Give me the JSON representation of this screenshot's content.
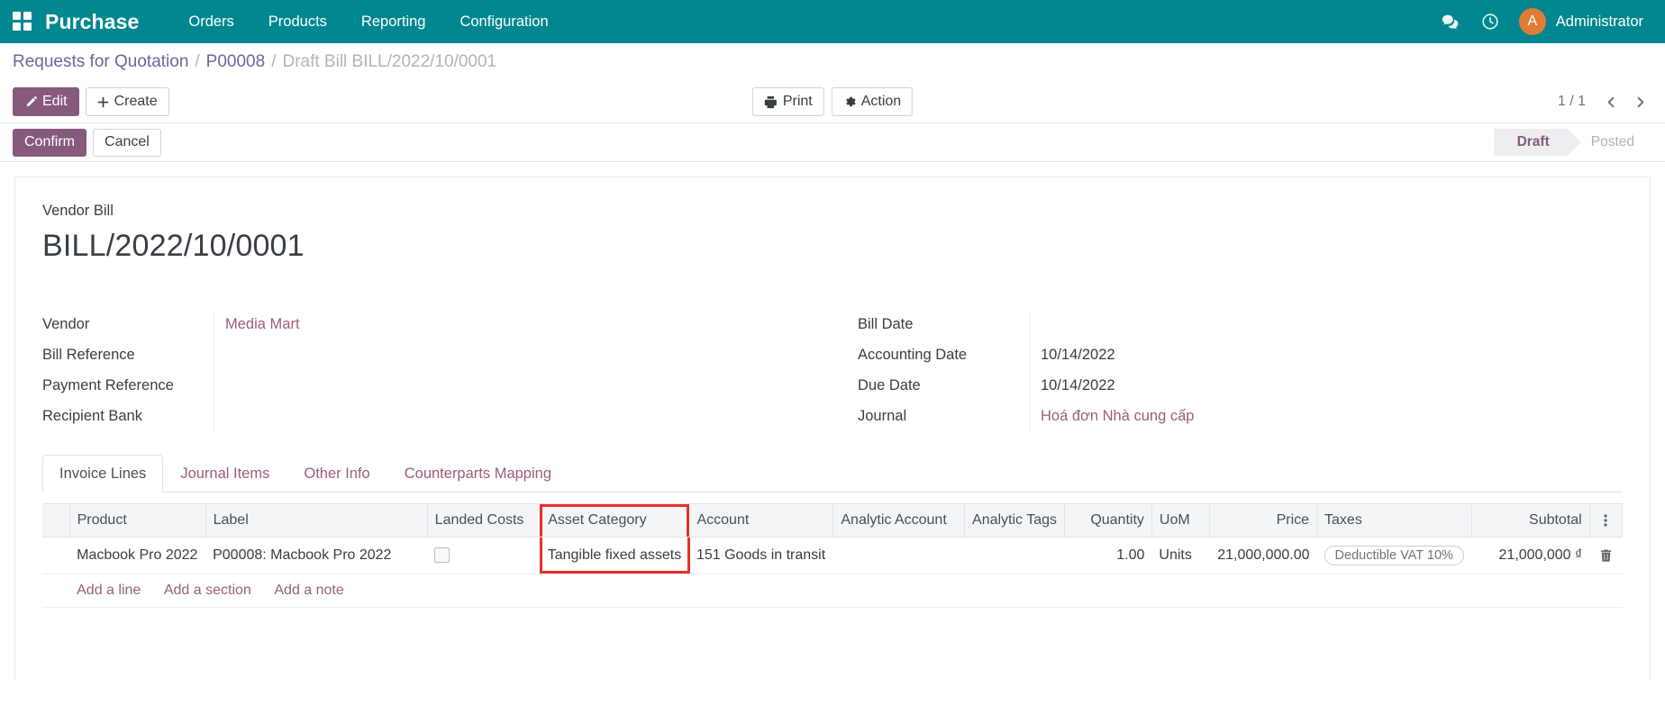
{
  "navbar": {
    "apps_icon": "apps-grid-icon",
    "brand": "Purchase",
    "menu": [
      {
        "label": "Orders"
      },
      {
        "label": "Products"
      },
      {
        "label": "Reporting"
      },
      {
        "label": "Configuration"
      }
    ],
    "messages_icon": "chat-bubble-icon",
    "activities_icon": "clock-icon",
    "avatar_initial": "A",
    "user_name": "Administrator",
    "brand_color": "#00878f",
    "avatar_color": "#e07b39"
  },
  "breadcrumb": {
    "items": [
      {
        "label": "Requests for Quotation",
        "active": false
      },
      {
        "label": "P00008",
        "active": false
      },
      {
        "label": "Draft Bill BILL/2022/10/0001",
        "active": true
      }
    ],
    "separator": "/"
  },
  "control_panel": {
    "edit_label": "Edit",
    "create_label": "Create",
    "print_label": "Print",
    "action_label": "Action",
    "pager_value": "1 / 1",
    "prev_icon": "chevron-left-icon",
    "next_icon": "chevron-right-icon"
  },
  "statusbar": {
    "confirm_label": "Confirm",
    "cancel_label": "Cancel",
    "steps": [
      {
        "label": "Draft",
        "state": "done"
      },
      {
        "label": "Posted",
        "state": "todo"
      }
    ],
    "active_color": "#875a7b"
  },
  "form": {
    "title_label": "Vendor Bill",
    "title": "BILL/2022/10/0001",
    "left_fields": [
      {
        "label": "Vendor",
        "value": "Media Mart",
        "is_link": true
      },
      {
        "label": "Bill Reference",
        "value": "",
        "is_link": false
      },
      {
        "label": "Payment Reference",
        "value": "",
        "is_link": false
      },
      {
        "label": "Recipient Bank",
        "value": "",
        "is_link": false
      }
    ],
    "right_fields": [
      {
        "label": "Bill Date",
        "value": "",
        "is_link": false
      },
      {
        "label": "Accounting Date",
        "value": "10/14/2022",
        "is_link": false
      },
      {
        "label": "Due Date",
        "value": "10/14/2022",
        "is_link": false
      },
      {
        "label": "Journal",
        "value": "Hoá đơn Nhà cung cấp",
        "is_link": true
      }
    ]
  },
  "notebook": {
    "tabs": [
      {
        "label": "Invoice Lines",
        "active": true
      },
      {
        "label": "Journal Items",
        "active": false
      },
      {
        "label": "Other Info",
        "active": false
      },
      {
        "label": "Counterparts Mapping",
        "active": false
      }
    ]
  },
  "lines_table": {
    "columns": [
      "Product",
      "Label",
      "Landed Costs",
      "Asset Category",
      "Account",
      "Analytic Account",
      "Analytic Tags",
      "Quantity",
      "UoM",
      "Price",
      "Taxes",
      "Subtotal"
    ],
    "optional_columns_icon": "vertical-dots-icon",
    "highlighted_column": "Asset Category",
    "highlight_color": "#e8302a",
    "rows": [
      {
        "product": "Macbook Pro 2022",
        "label": "P00008: Macbook Pro 2022",
        "landed_costs_checked": false,
        "asset_category": "Tangible fixed assets",
        "account": "151 Goods in transit",
        "analytic_account": "",
        "analytic_tags": "",
        "quantity": "1.00",
        "uom": "Units",
        "price": "21,000,000.00",
        "taxes": "Deductible VAT 10%",
        "subtotal": "21,000,000 ₫",
        "delete_icon": "trash-icon"
      }
    ],
    "add_links": [
      {
        "label": "Add a line"
      },
      {
        "label": "Add a section"
      },
      {
        "label": "Add a note"
      }
    ]
  }
}
